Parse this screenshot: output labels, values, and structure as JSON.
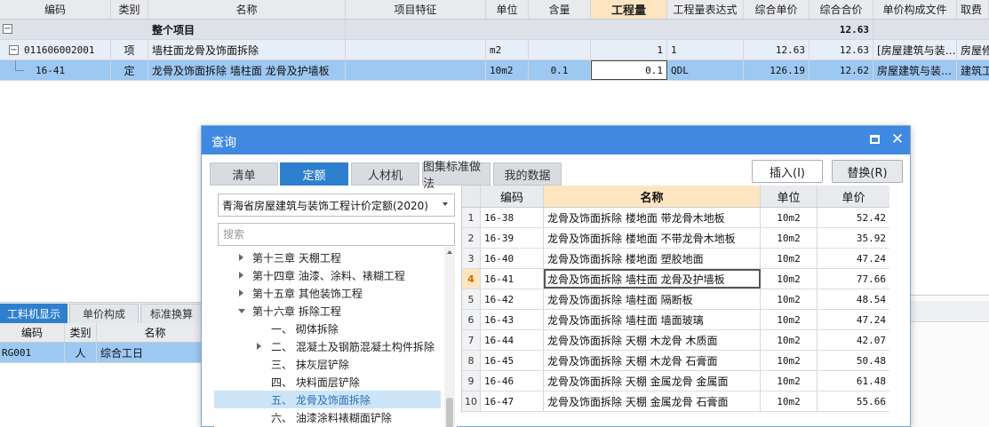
{
  "top_grid": {
    "headers": [
      "编码",
      "类别",
      "名称",
      "项目特征",
      "单位",
      "含量",
      "工程量",
      "工程量表达式",
      "综合单价",
      "综合合价",
      "单价构成文件",
      "取费"
    ],
    "rows": [
      {
        "code": "",
        "type": "",
        "name": "整个项目",
        "feature": "",
        "unit": "",
        "content": "",
        "qty": "",
        "expr": "",
        "price": "",
        "total": "12.63",
        "file": "",
        "fee": ""
      },
      {
        "code": "011606002001",
        "type": "项",
        "name": "墙柱面龙骨及饰面拆除",
        "feature": "",
        "unit": "m2",
        "content": "",
        "qty": "1",
        "expr": "1",
        "price": "12.63",
        "total": "12.63",
        "file": "[房屋建筑与装…",
        "fee": "房屋修"
      },
      {
        "code": "16-41",
        "type": "定",
        "name": "龙骨及饰面拆除 墙柱面 龙骨及护墙板",
        "feature": "",
        "unit": "10m2",
        "content": "0.1",
        "qty": "0.1",
        "expr": "QDL",
        "price": "126.19",
        "total": "12.62",
        "file": "房屋建筑与装…",
        "fee": "建筑工"
      }
    ],
    "toggle_minus": "−"
  },
  "bottom_panel": {
    "tabs": [
      "工料机显示",
      "单价构成",
      "标准换算"
    ],
    "headers": [
      "编码",
      "类别",
      "名称"
    ],
    "row": {
      "code": "RG001",
      "type": "人",
      "name": "综合工日"
    }
  },
  "dialog": {
    "title": "查询",
    "close": "✕",
    "tabs": [
      "清单",
      "定额",
      "人材机",
      "图集标准做法",
      "我的数据"
    ],
    "insert_label": "插入(I)",
    "replace_label": "替换(R)",
    "dataset": "青海省房屋建筑与装饰工程计价定额(2020)",
    "search_placeholder": "搜索",
    "tree": [
      "第十三章 天棚工程",
      "第十四章 油漆、涂料、裱糊工程",
      "第十五章 其他装饰工程",
      "第十六章 拆除工程",
      "一、 砌体拆除",
      "二、 混凝土及钢筋混凝土构件拆除",
      "三、 抹灰层铲除",
      "四、 块料面层铲除",
      "五、 龙骨及饰面拆除",
      "六、 油漆涂料裱糊面铲除"
    ],
    "results": {
      "headers": [
        "编码",
        "名称",
        "单位",
        "单价"
      ],
      "rows": [
        {
          "n": "1",
          "code": "16-38",
          "name": "龙骨及饰面拆除 楼地面 带龙骨木地板",
          "unit": "10m2",
          "price": "52.42"
        },
        {
          "n": "2",
          "code": "16-39",
          "name": "龙骨及饰面拆除 楼地面 不带龙骨木地板",
          "unit": "10m2",
          "price": "35.92"
        },
        {
          "n": "3",
          "code": "16-40",
          "name": "龙骨及饰面拆除 楼地面 塑胶地面",
          "unit": "10m2",
          "price": "47.24"
        },
        {
          "n": "4",
          "code": "16-41",
          "name": "龙骨及饰面拆除 墙柱面 龙骨及护墙板",
          "unit": "10m2",
          "price": "77.66"
        },
        {
          "n": "5",
          "code": "16-42",
          "name": "龙骨及饰面拆除 墙柱面 隔断板",
          "unit": "10m2",
          "price": "48.54"
        },
        {
          "n": "6",
          "code": "16-43",
          "name": "龙骨及饰面拆除 墙柱面 墙面玻璃",
          "unit": "10m2",
          "price": "47.24"
        },
        {
          "n": "7",
          "code": "16-44",
          "name": "龙骨及饰面拆除 天棚 木龙骨 木质面",
          "unit": "10m2",
          "price": "42.07"
        },
        {
          "n": "8",
          "code": "16-45",
          "name": "龙骨及饰面拆除 天棚 木龙骨 石膏面",
          "unit": "10m2",
          "price": "50.48"
        },
        {
          "n": "9",
          "code": "16-46",
          "name": "龙骨及饰面拆除 天棚 金属龙骨 金属面",
          "unit": "10m2",
          "price": "61.48"
        },
        {
          "n": "10",
          "code": "16-47",
          "name": "龙骨及饰面拆除 天棚 金属龙骨 石膏面",
          "unit": "10m2",
          "price": "55.66"
        }
      ]
    }
  },
  "colors": {
    "accent": "#3f8ae0",
    "active_tab": "#2f7fcf",
    "selected_row": "#9cc8f2",
    "header_highlight": "#fde5c2"
  }
}
